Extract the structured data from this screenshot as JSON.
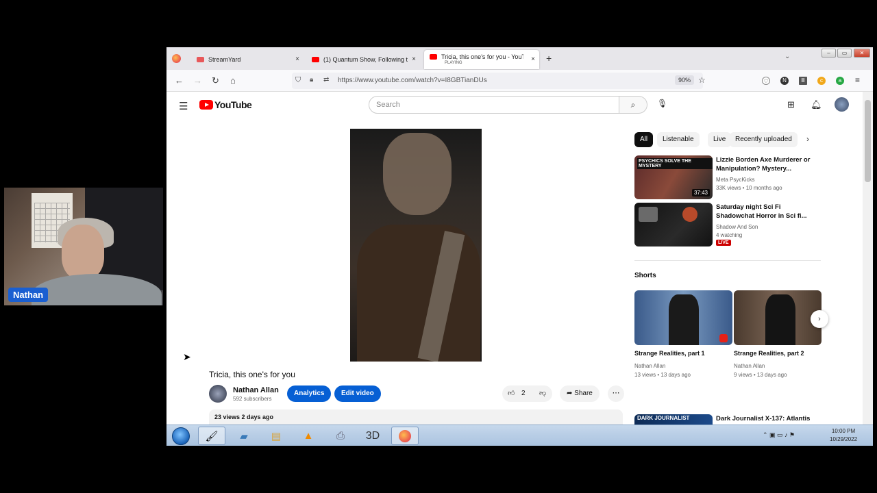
{
  "webcam": {
    "name_tag": "Nathan"
  },
  "browser": {
    "tabs": [
      {
        "title": "StreamYard",
        "subtitle": "",
        "favicon_color": "#e8585a"
      },
      {
        "title": "(1) Quantum Show, Following t",
        "subtitle": "",
        "favicon_color": "#ff0000"
      },
      {
        "title": "Tricia, this one's for you - YouTu",
        "subtitle": "PLAYING",
        "favicon_color": "#ff0000"
      }
    ],
    "close_glyph": "×",
    "new_tab": "+",
    "url": "https://www.youtube.com/watch?v=I8GBTianDUs",
    "zoom": "90%"
  },
  "youtube": {
    "logo_text": "YouTube",
    "search_placeholder": "Search",
    "video": {
      "title": "Tricia, this one's for you",
      "channel": "Nathan Allan",
      "subscribers": "592 subscribers",
      "analytics_label": "Analytics",
      "edit_label": "Edit video",
      "likes": "2",
      "share_label": "Share",
      "views_date": "23 views  2 days ago"
    },
    "chips": [
      "All",
      "Listenable",
      "Live",
      "Recently uploaded"
    ],
    "related": [
      {
        "title": "Lizzie Borden Axe Murderer or Manipulation? Mystery...",
        "channel": "Meta PsycKicks",
        "meta": "33K views • 10 months ago",
        "duration": "37:43",
        "thumb_caption": "PSYCHICS SOLVE THE MYSTERY",
        "live": ""
      },
      {
        "title": "Saturday night Sci Fi Shadowchat Horror in Sci fi...",
        "channel": "Shadow And Son",
        "meta": "4 watching",
        "duration": "",
        "thumb_caption": "",
        "live": "LIVE"
      },
      {
        "title": "Dark Journalist X-137: Atlantis",
        "channel": "",
        "meta": "",
        "duration": "",
        "thumb_caption": "DARK JOURNALIST",
        "live": ""
      }
    ],
    "shorts_heading": "Shorts",
    "shorts": [
      {
        "title": "Strange Realities, part 1",
        "channel": "Nathan Allan",
        "meta": "13 views • 13 days ago"
      },
      {
        "title": "Strange Realities, part 2",
        "channel": "Nathan Allan",
        "meta": "9 views • 13 days ago"
      }
    ]
  },
  "taskbar": {
    "items": [
      "paint-icon",
      "window-icon",
      "folder-icon",
      "vlc-icon",
      "printer-icon",
      "3d-icon",
      "firefox-icon"
    ],
    "label_3d": "3D",
    "clock_time": "10:00 PM",
    "clock_date": "10/29/2022"
  }
}
